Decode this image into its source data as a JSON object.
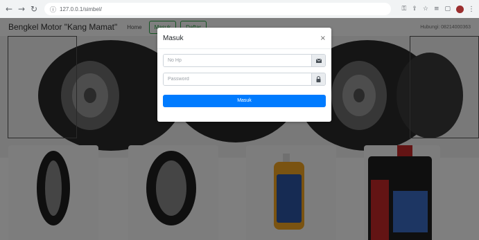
{
  "browser": {
    "url": "127.0.0.1/simbel/"
  },
  "navbar": {
    "brand": "Bengkel Motor \"Kang Mamat\"",
    "home_label": "Home",
    "masuk_label": "Masuk",
    "daftar_label": "Daftar",
    "contact": "Hubungi: 08214000363"
  },
  "modal": {
    "title": "Masuk",
    "close": "×",
    "phone_placeholder": "No Hp",
    "password_placeholder": "Password",
    "submit_label": "Masuk"
  },
  "colors": {
    "primary": "#007bff",
    "success": "#28a745",
    "overlay": "rgba(0,0,0,0.5)"
  },
  "icons": {
    "phone_field": "envelope-icon",
    "password_field": "lock-icon"
  }
}
